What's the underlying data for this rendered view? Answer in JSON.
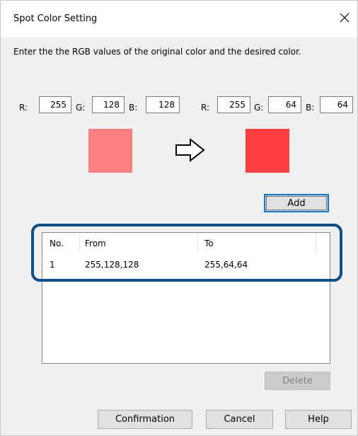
{
  "window": {
    "title": "Spot Color Setting",
    "close_icon": "close-icon"
  },
  "instructions": "Enter the the RGB values of the original color and the desired color.",
  "original": {
    "r_label": "R:",
    "g_label": "G:",
    "b_label": "B:",
    "r": "255",
    "g": "128",
    "b": "128",
    "swatch_color": "#ff8080"
  },
  "desired": {
    "r_label": "R:",
    "g_label": "G:",
    "b_label": "B:",
    "r": "255",
    "g": "64",
    "b": "64",
    "swatch_color": "#ff4040"
  },
  "arrow_icon": "arrow-right-outline-icon",
  "add_label": "Add",
  "list": {
    "headers": {
      "no": "No.",
      "from": "From",
      "to": "To"
    },
    "rows": [
      {
        "no": "1",
        "from": "255,128,128",
        "to": "255,64,64"
      }
    ]
  },
  "delete_label": "Delete",
  "footer": {
    "confirmation": "Confirmation",
    "cancel": "Cancel",
    "help": "Help"
  },
  "colors": {
    "highlight": "#0d4f8b",
    "default_button_border": "#0078d7"
  }
}
